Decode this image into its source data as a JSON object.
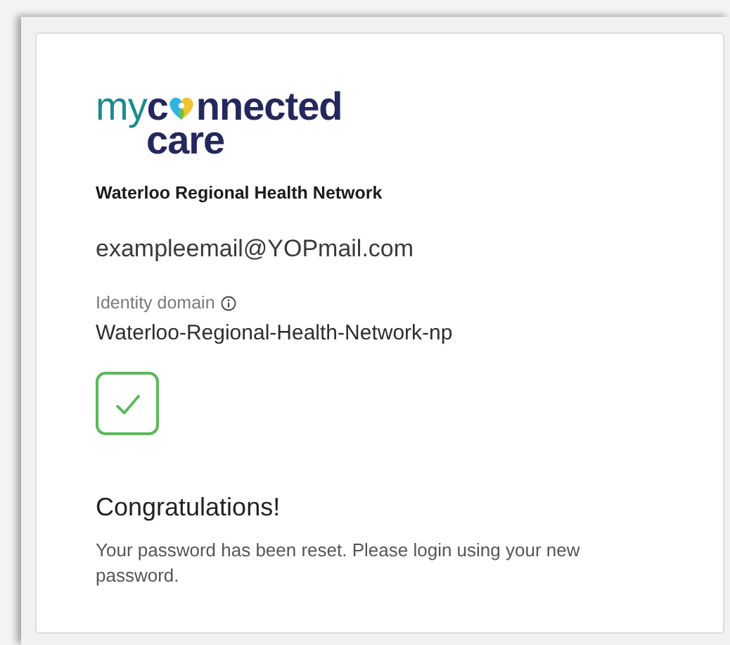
{
  "logo": {
    "prefix": "my",
    "word_start": "c",
    "word_end": "nnected",
    "second_line": "care"
  },
  "organization": "Waterloo Regional Health Network",
  "email": "exampleemail@YOPmail.com",
  "identity_domain": {
    "label": "Identity domain",
    "value": "Waterloo-Regional-Health-Network-np"
  },
  "status": {
    "kind": "success"
  },
  "heading": "Congratulations!",
  "message": "Your password has been reset. Please login using your new password."
}
